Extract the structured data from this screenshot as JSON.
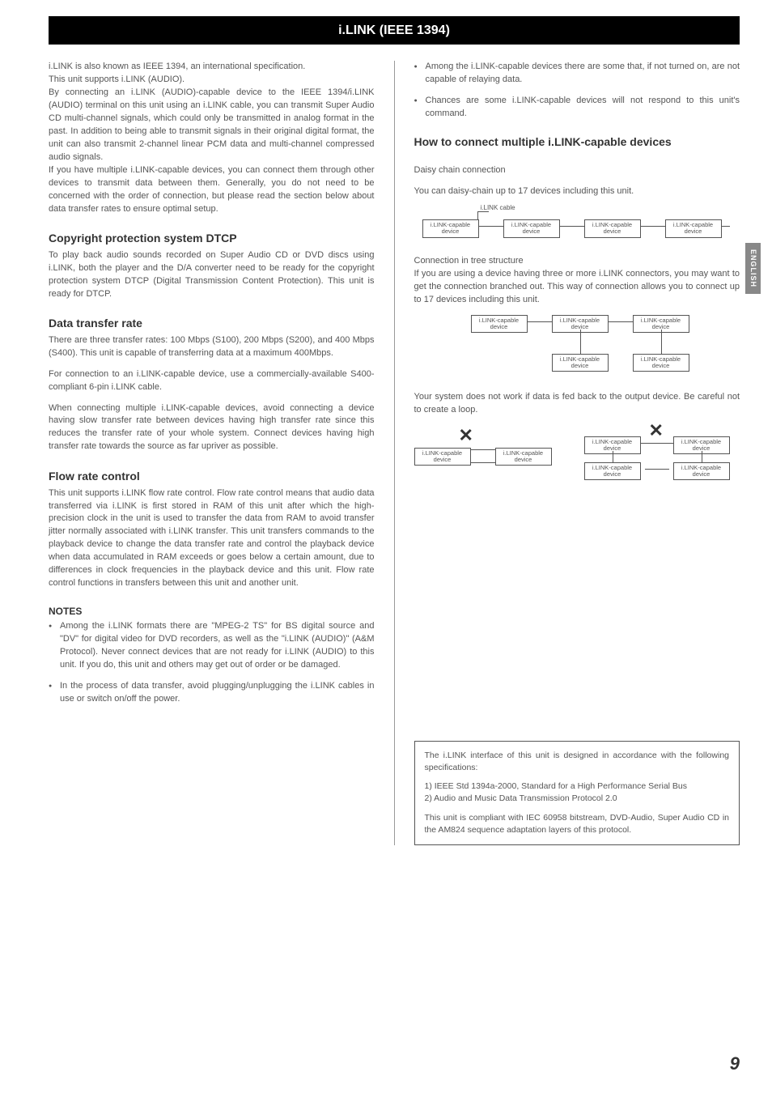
{
  "header": "i.LINK (IEEE 1394)",
  "sideTab": "ENGLISH",
  "pageNum": "9",
  "left": {
    "intro1": "i.LINK is also known as IEEE 1394, an international specification.",
    "intro2": "This unit supports i.LINK (AUDIO).",
    "intro3": "By connecting an i.LINK (AUDIO)-capable device to the IEEE 1394/i.LINK (AUDIO) terminal on this unit using an i.LINK cable, you can transmit Super Audio CD multi-channel signals, which could only be transmitted in analog format in the past. In addition to being able to transmit signals in their original digital format, the unit can also transmit 2-channel linear PCM data and multi-channel compressed audio signals.",
    "intro4": "If you have multiple i.LINK-capable devices, you can connect them through other devices to transmit data between them. Generally, you do not need to be concerned with the order of connection, but please read the section below about data transfer rates to ensure optimal setup.",
    "copyHeading": "Copyright protection system DTCP",
    "copyBody": "To play back audio sounds recorded on Super Audio CD or DVD discs using i.LINK, both the player and the D/A converter need to be ready for the copyright protection system DTCP (Digital Transmission Content Protection). This unit is ready for DTCP.",
    "dataHeading": "Data transfer rate",
    "data1": "There are three transfer rates: 100 Mbps (S100), 200 Mbps (S200), and 400 Mbps (S400). This unit is capable of transferring data at a maximum 400Mbps.",
    "data2": "For connection to an i.LINK-capable device, use a commercially-available S400-compliant 6-pin i.LINK cable.",
    "data3": "When connecting multiple i.LINK-capable devices, avoid connecting a device having slow transfer rate between devices having high transfer rate since this reduces the transfer rate of your whole system. Connect devices having high transfer rate towards the source as far upriver as possible.",
    "flowHeading": "Flow rate control",
    "flowBody": "This unit supports i.LINK flow rate control. Flow rate control means that audio data transferred via i.LINK is first stored in RAM of this unit after which the high-precision clock in the unit is used to transfer the data from RAM to avoid transfer jitter normally associated with i.LINK transfer. This unit transfers commands to the playback device to change the data transfer rate and control the playback device when data accumulated in RAM exceeds or goes below a certain amount, due to differences in clock frequencies in the playback device and this unit. Flow rate control functions in transfers between this unit and another unit.",
    "notesHeading": "NOTES",
    "notes": [
      "Among the i.LINK formats there are \"MPEG-2 TS\" for BS digital source and \"DV\" for digital video for DVD recorders, as well as the \"i.LINK (AUDIO)\" (A&M Protocol). Never connect devices that are not ready for i.LINK (AUDIO) to this unit. If you do, this unit and others may get out of order or be damaged.",
      "In the process of data transfer, avoid plugging/unplugging the i.LINK cables in use or switch on/off the power."
    ]
  },
  "right": {
    "bullets": [
      "Among the i.LINK-capable devices there are some that, if not turned on, are not capable of relaying data.",
      "Chances are some i.LINK-capable devices will not respond to this unit's command."
    ],
    "howHeading": "How to connect multiple i.LINK-capable devices",
    "daisy": "Daisy chain connection",
    "daisyText": "You can daisy-chain up to 17 devices including this unit.",
    "cableLabel": "i.LINK cable",
    "devLabel": "i.LINK-capable device",
    "tree": "Connection in tree structure",
    "treeText": "If you are using a device having three or more i.LINK connectors, you may want to get the connection branched out. This way of connection allows you to connect up to 17 devices including this unit.",
    "loopText": "Your system does not work if data is fed back to the output device. Be careful not to create a loop.",
    "spec1": "The i.LINK interface of this unit is designed in accordance with the following specifications:",
    "spec2a": "1) IEEE Std 1394a-2000, Standard for a High Performance Serial Bus",
    "spec2b": "2) Audio and Music Data Transmission Protocol 2.0",
    "spec3": "This unit is compliant with IEC 60958 bitstream, DVD-Audio, Super Audio CD in the AM824 sequence adaptation layers of this protocol."
  }
}
